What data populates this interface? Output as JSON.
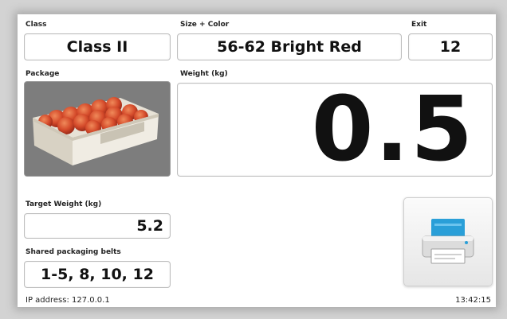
{
  "class": {
    "label": "Class",
    "value": "Class II"
  },
  "size_color": {
    "label": "Size + Color",
    "value": "56-62 Bright Red"
  },
  "exit": {
    "label": "Exit",
    "value": "12"
  },
  "package": {
    "label": "Package",
    "image": "box-of-red-apples"
  },
  "weight": {
    "label": "Weight (kg)",
    "value": "0.5"
  },
  "target_weight": {
    "label": "Target Weight (kg)",
    "value": "5.2"
  },
  "shared_belts": {
    "label": "Shared packaging belts",
    "value": "1-5, 8, 10, 12"
  },
  "print_button": {
    "icon": "printer-icon"
  },
  "footer": {
    "ip_address": "IP address: 127.0.0.1",
    "time": "13:42:15"
  },
  "colors": {
    "printer_accent": "#2a9fd8",
    "field_border": "#bdbdbd"
  }
}
